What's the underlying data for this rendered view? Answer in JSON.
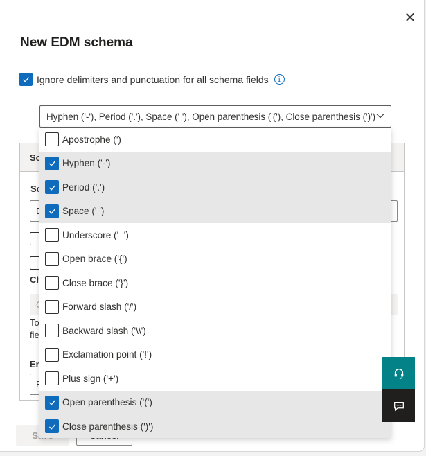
{
  "dialog": {
    "title": "New EDM schema",
    "close_glyph": "✕",
    "ignore_checkbox": {
      "label": "Ignore delimiters and punctuation for all schema fields",
      "checked": true
    },
    "info_glyph": "i"
  },
  "dropdown": {
    "selected_text": "Hyphen ('-'), Period ('.'), Space (' '), Open parenthesis ('('), Close parenthesis (')')",
    "options": [
      {
        "label": "Apostrophe (')",
        "checked": false
      },
      {
        "label": "Hyphen ('-')",
        "checked": true
      },
      {
        "label": "Period ('.')",
        "checked": true
      },
      {
        "label": "Space (' ')",
        "checked": true
      },
      {
        "label": "Underscore ('_')",
        "checked": false
      },
      {
        "label": "Open brace ('{')",
        "checked": false
      },
      {
        "label": "Close brace ('}')",
        "checked": false
      },
      {
        "label": "Forward slash ('/')",
        "checked": false
      },
      {
        "label": "Backward slash ('\\\\')",
        "checked": false
      },
      {
        "label": "Exclamation point ('!')",
        "checked": false
      },
      {
        "label": "Plus sign ('+')",
        "checked": false
      },
      {
        "label": "Open parenthesis ('(')",
        "checked": true
      },
      {
        "label": "Close parenthesis (')')",
        "checked": true
      }
    ]
  },
  "background_form": {
    "header_fragment": "Sc",
    "label_fragment_1": "Sc",
    "input_fragment_1": "E",
    "label_fragment_2": "Ch",
    "input_fragment_2": "C",
    "text_fragment_1": "To",
    "text_fragment_2": "fie",
    "label_fragment_3": "En",
    "input_fragment_3": "E"
  },
  "footer": {
    "save_label": "Save",
    "cancel_label": "Cancel"
  },
  "side_buttons": {
    "help_icon": "headset-icon",
    "feedback_icon": "feedback-icon"
  },
  "colors": {
    "accent": "#0f6cbd",
    "help_button": "#038387",
    "feedback_button": "#201f1e",
    "selected_row": "#e7e7e7"
  }
}
